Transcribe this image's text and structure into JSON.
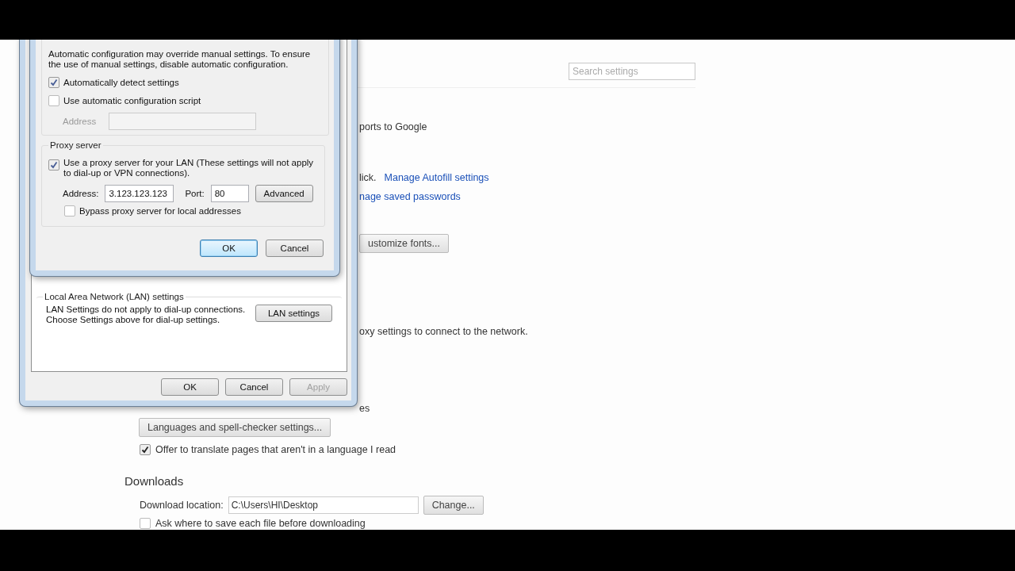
{
  "settings": {
    "search": {
      "placeholder": "Search settings"
    },
    "fragments": [
      {
        "kind": "text",
        "text": "ports to Google"
      },
      {
        "kind": "text_link",
        "text": "lick.",
        "link": "Manage Autofill settings"
      },
      {
        "kind": "link",
        "text": "nage saved passwords"
      },
      {
        "kind": "button",
        "text": "ustomize fonts..."
      },
      {
        "kind": "text",
        "text": "oxy settings to connect to the network."
      },
      {
        "kind": "text",
        "text": "es"
      }
    ],
    "languages_button": "Languages and spell-checker settings...",
    "translate": {
      "label": "Offer to translate pages that aren't in a language I read",
      "checked": true
    },
    "downloads": {
      "heading": "Downloads",
      "location_label": "Download location:",
      "location_value": "C:\\Users\\HI\\Desktop",
      "change_button": "Change...",
      "ask": {
        "label": "Ask where to save each file before downloading",
        "checked": false
      }
    }
  },
  "internet_properties": {
    "lan_group": {
      "title": "Local Area Network (LAN) settings",
      "lines": [
        "LAN Settings do not apply to dial-up connections.",
        "Choose Settings above for dial-up settings."
      ],
      "button": "LAN settings"
    },
    "buttons": [
      {
        "label": "OK",
        "disabled": false
      },
      {
        "label": "Cancel",
        "disabled": false
      },
      {
        "label": "Apply",
        "disabled": true
      }
    ]
  },
  "lan_settings": {
    "auto_config": {
      "description": "Automatic configuration may override manual settings.  To ensure the use of manual settings, disable automatic configuration.",
      "checkboxes": [
        {
          "label": "Automatically detect settings",
          "checked": true
        },
        {
          "label": "Use automatic configuration script",
          "checked": false
        }
      ],
      "address": {
        "label": "Address",
        "disabled": true
      }
    },
    "proxy": {
      "title": "Proxy server",
      "use_proxy": {
        "label": "Use a proxy server for your LAN (These settings will not apply to dial-up or VPN connections).",
        "checked": true
      },
      "address_label": "Address:",
      "address_value": "3.123.123.123",
      "port_label": "Port:",
      "port_value": "80",
      "advanced_button": "Advanced",
      "bypass": {
        "label": "Bypass proxy server for local addresses",
        "checked": false
      }
    },
    "buttons": [
      {
        "label": "OK",
        "default": true
      },
      {
        "label": "Cancel",
        "default": false
      }
    ]
  }
}
